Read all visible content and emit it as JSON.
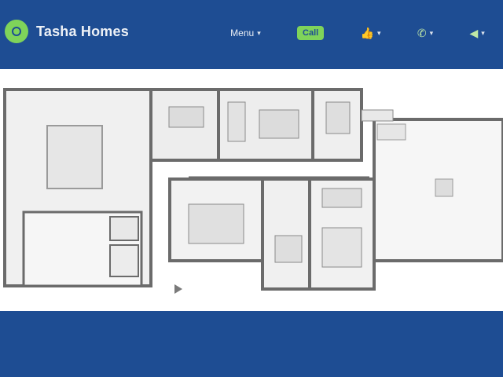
{
  "header": {
    "brand_name": "Tasha Homes",
    "brand_icon": "logo-icon",
    "nav": [
      {
        "label": "Menu",
        "icon": "",
        "style": "link"
      },
      {
        "label": "Call",
        "icon": "",
        "style": "pill"
      },
      {
        "label": "",
        "icon": "thumbs-up-icon",
        "style": "icon"
      },
      {
        "label": "",
        "icon": "phone-icon",
        "style": "icon"
      },
      {
        "label": "",
        "icon": "share-icon",
        "style": "icon"
      }
    ]
  },
  "floorplan": {
    "image": "house-floor-plan",
    "label": ""
  },
  "colors": {
    "primary": "#1e4d93",
    "accent": "#7fd35a",
    "background": "#ffffff"
  }
}
